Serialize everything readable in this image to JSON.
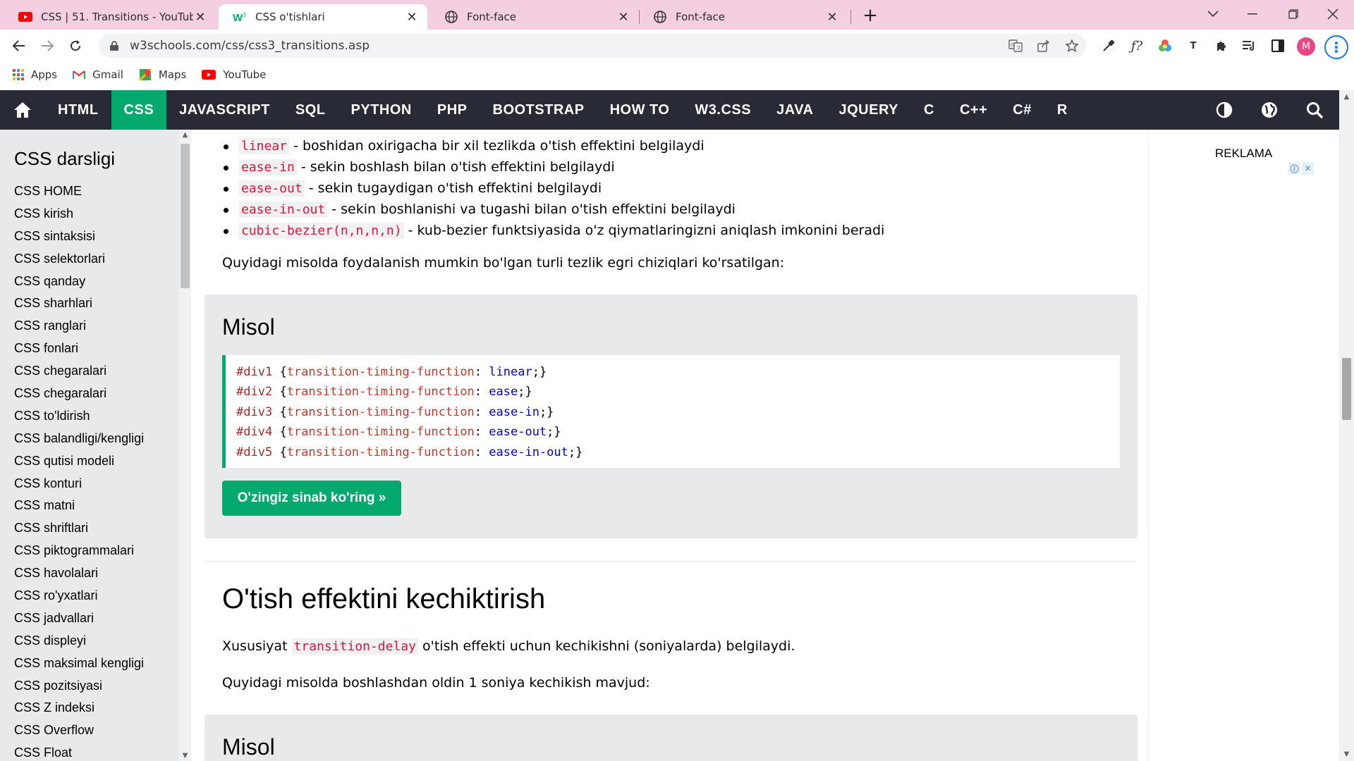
{
  "browser": {
    "tabs": [
      {
        "title": "CSS | 51. Transitions - YouTube",
        "icon": "youtube-icon"
      },
      {
        "title": "CSS o'tishlari",
        "icon": "w3schools-icon"
      },
      {
        "title": "Font-face",
        "icon": "globe-icon"
      },
      {
        "title": "Font-face",
        "icon": "globe-icon"
      }
    ],
    "url": "w3schools.com/css/css3_transitions.asp",
    "profile_initial": "M",
    "bookmarks": [
      {
        "label": "Apps",
        "icon": "apps-grid-icon"
      },
      {
        "label": "Gmail",
        "icon": "gmail-icon"
      },
      {
        "label": "Maps",
        "icon": "maps-icon"
      },
      {
        "label": "YouTube",
        "icon": "youtube-icon"
      }
    ]
  },
  "w3nav": {
    "items": [
      "HTML",
      "CSS",
      "JAVASCRIPT",
      "SQL",
      "PYTHON",
      "PHP",
      "BOOTSTRAP",
      "HOW TO",
      "W3.CSS",
      "JAVA",
      "JQUERY",
      "C",
      "C++",
      "C#",
      "R"
    ],
    "active": "CSS",
    "active_color": "#04aa6d",
    "bg_color": "#282a35"
  },
  "sidebar": {
    "title": "CSS darsligi",
    "links": [
      "CSS HOME",
      "CSS kirish",
      "CSS sintaksisi",
      "CSS selektorlari",
      "CSS qanday",
      "CSS sharhlari",
      "CSS ranglari",
      "CSS fonlari",
      "CSS chegaralari",
      "CSS chegaralari",
      "CSS to'ldirish",
      "CSS balandligi/kengligi",
      "CSS qutisi modeli",
      "CSS konturi",
      "CSS matni",
      "CSS shriftlari",
      "CSS piktogrammalari",
      "CSS havolalari",
      "CSS ro'yxatlari",
      "CSS jadvallari",
      "CSS displeyi",
      "CSS maksimal kengligi",
      "CSS pozitsiyasi",
      "CSS Z indeksi",
      "CSS Overflow",
      "CSS Float"
    ]
  },
  "main": {
    "bullets": [
      {
        "code": "linear",
        "text": " - boshidan oxirigacha bir xil tezlikda o'tish effektini belgilaydi"
      },
      {
        "code": "ease-in",
        "text": " - sekin boshlash bilan o'tish effektini belgilaydi"
      },
      {
        "code": "ease-out",
        "text": " - sekin tugaydigan o'tish effektini belgilaydi"
      },
      {
        "code": "ease-in-out",
        "text": " - sekin boshlanishi va tugashi bilan o'tish effektini belgilaydi"
      },
      {
        "code": "cubic-bezier(n,n,n,n)",
        "text": " - kub-bezier funktsiyasida o'z qiymatlaringizni aniqlash imkonini beradi"
      }
    ],
    "intro": "Quyidagi misolda foydalanish mumkin bo'lgan turli tezlik egri chiziqlari ko'rsatilgan:",
    "example1": {
      "heading": "Misol",
      "code": [
        {
          "sel": "#div1",
          "prop": "transition-timing-function",
          "val": "linear"
        },
        {
          "sel": "#div2",
          "prop": "transition-timing-function",
          "val": "ease"
        },
        {
          "sel": "#div3",
          "prop": "transition-timing-function",
          "val": "ease-in"
        },
        {
          "sel": "#div4",
          "prop": "transition-timing-function",
          "val": "ease-out"
        },
        {
          "sel": "#div5",
          "prop": "transition-timing-function",
          "val": "ease-in-out"
        }
      ],
      "button": "O'zingiz sinab ko'ring »"
    },
    "section2": {
      "heading": "O'tish effektini kechiktirish",
      "p1_before": "Xususiyat ",
      "p1_code": "transition-delay",
      "p1_after": " o'tish effekti uchun kechikishni (soniyalarda) belgilaydi.",
      "p2": "Quyidagi misolda boshlashdan oldin 1 soniya kechikish mavjud:",
      "example_heading": "Misol"
    }
  },
  "rightcol": {
    "ad_label": "REKLAMA"
  }
}
